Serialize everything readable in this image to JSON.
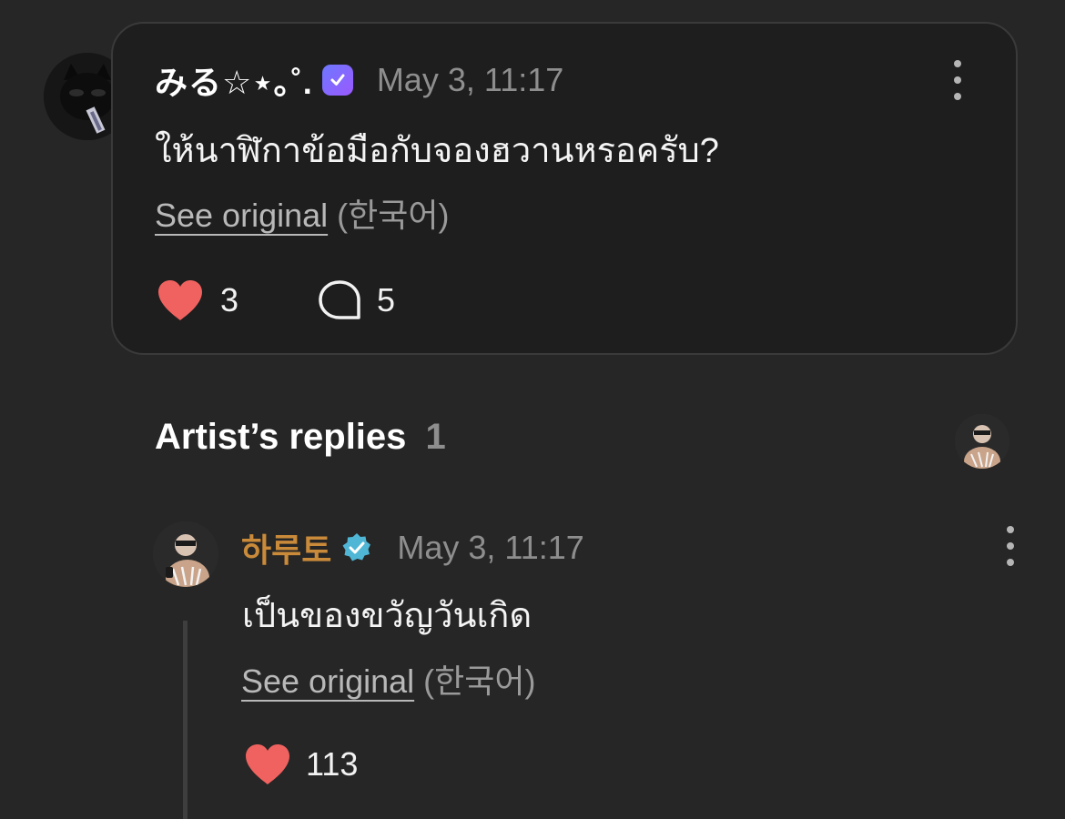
{
  "comment": {
    "username": "みる☆⋆｡˚.",
    "timestamp": "May 3, 11:17",
    "text": "ให้นาฬิกาข้อมือกับจองฮวานหรอครับ?",
    "see_original": "See original",
    "language": "(한국어)",
    "likes": "3",
    "replies": "5",
    "avatar_icon": "black-cat-avatar",
    "badge_icon": "purple-verified-badge-icon"
  },
  "artist_replies": {
    "title": "Artist’s replies",
    "count": "1"
  },
  "reply": {
    "username": "하루토",
    "timestamp": "May 3, 11:17",
    "text": "เป็นของขวัญวันเกิด",
    "see_original": "See original",
    "language": "(한국어)",
    "likes": "113",
    "badge_icon": "blue-verified-badge-icon"
  },
  "colors": {
    "background": "#262626",
    "card": "#1e1e1e",
    "heart": "#f0625f",
    "artist_name": "#c98a3a",
    "verified_blue": "#4fb6d6"
  }
}
